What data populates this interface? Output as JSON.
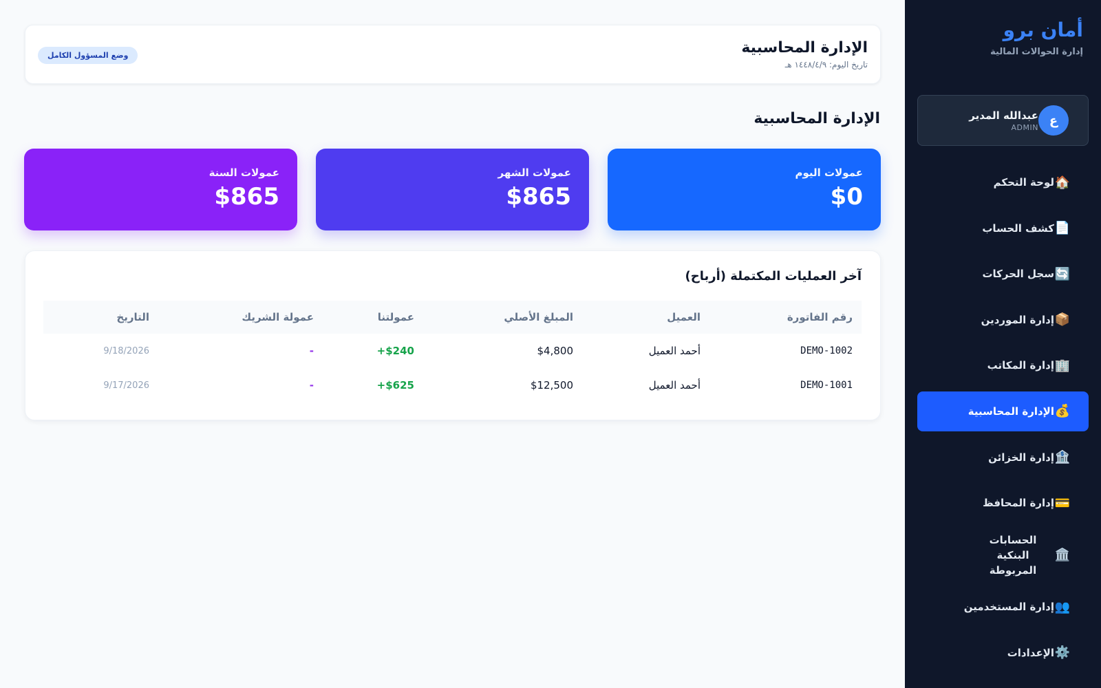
{
  "brand": {
    "name": "أمان برو",
    "subtitle": "إدارة الحوالات المالية"
  },
  "user": {
    "avatar_letter": "ع",
    "name": "عبدالله المدير",
    "role": "ADMIN"
  },
  "nav": {
    "items": [
      {
        "icon": "🏠",
        "label": "لوحة التحكم"
      },
      {
        "icon": "📄",
        "label": "كشف الحساب"
      },
      {
        "icon": "🔄",
        "label": "سجل الحركات"
      },
      {
        "icon": "📦",
        "label": "إدارة الموردين"
      },
      {
        "icon": "🏢",
        "label": "إدارة المكاتب"
      },
      {
        "icon": "💰",
        "label": "الإدارة المحاسبية"
      },
      {
        "icon": "🏦",
        "label": "إدارة الخزائن"
      },
      {
        "icon": "💳",
        "label": "إدارة المحافظ"
      },
      {
        "icon": "🏛️",
        "label": "الحسابات البنكية المربوطة"
      },
      {
        "icon": "👥",
        "label": "إدارة المستخدمين"
      },
      {
        "icon": "⚙️",
        "label": "الإعدادات"
      }
    ],
    "active_index": 5
  },
  "header": {
    "title": "الإدارة المحاسبية",
    "date": "تاريخ اليوم: ١٤٤٨/٤/٩ هـ",
    "badge": "وضع المسؤول الكامل"
  },
  "section": {
    "title": "الإدارة المحاسبية"
  },
  "stats": {
    "today": {
      "label": "عمولات اليوم",
      "value": "$0"
    },
    "month": {
      "label": "عمولات الشهر",
      "value": "$865"
    },
    "year": {
      "label": "عمولات السنة",
      "value": "$865"
    }
  },
  "colors": {
    "sidebar_bg": "#0f172a",
    "accent": "#1d5cff",
    "today_card": "#1668ff",
    "month_card": "#4f3cf0",
    "year_card": "#8a22f8",
    "profit_green": "#16a34a",
    "partner_purple": "#9333ea"
  },
  "table": {
    "title": "آخر العمليات المكتملة (أرباح)",
    "headers": {
      "invoice": "رقم الفاتورة",
      "client": "العميل",
      "amount": "المبلغ الأصلي",
      "ours": "عمولتنا",
      "partner": "عمولة الشريك",
      "date": "التاريخ"
    },
    "rows": [
      {
        "invoice": "DEMO-1002",
        "client": "أحمد العميل",
        "amount": "$4,800",
        "ours": "+$240",
        "partner": "-",
        "date": "9/18/2026"
      },
      {
        "invoice": "DEMO-1001",
        "client": "أحمد العميل",
        "amount": "$12,500",
        "ours": "+$625",
        "partner": "-",
        "date": "9/17/2026"
      }
    ]
  }
}
